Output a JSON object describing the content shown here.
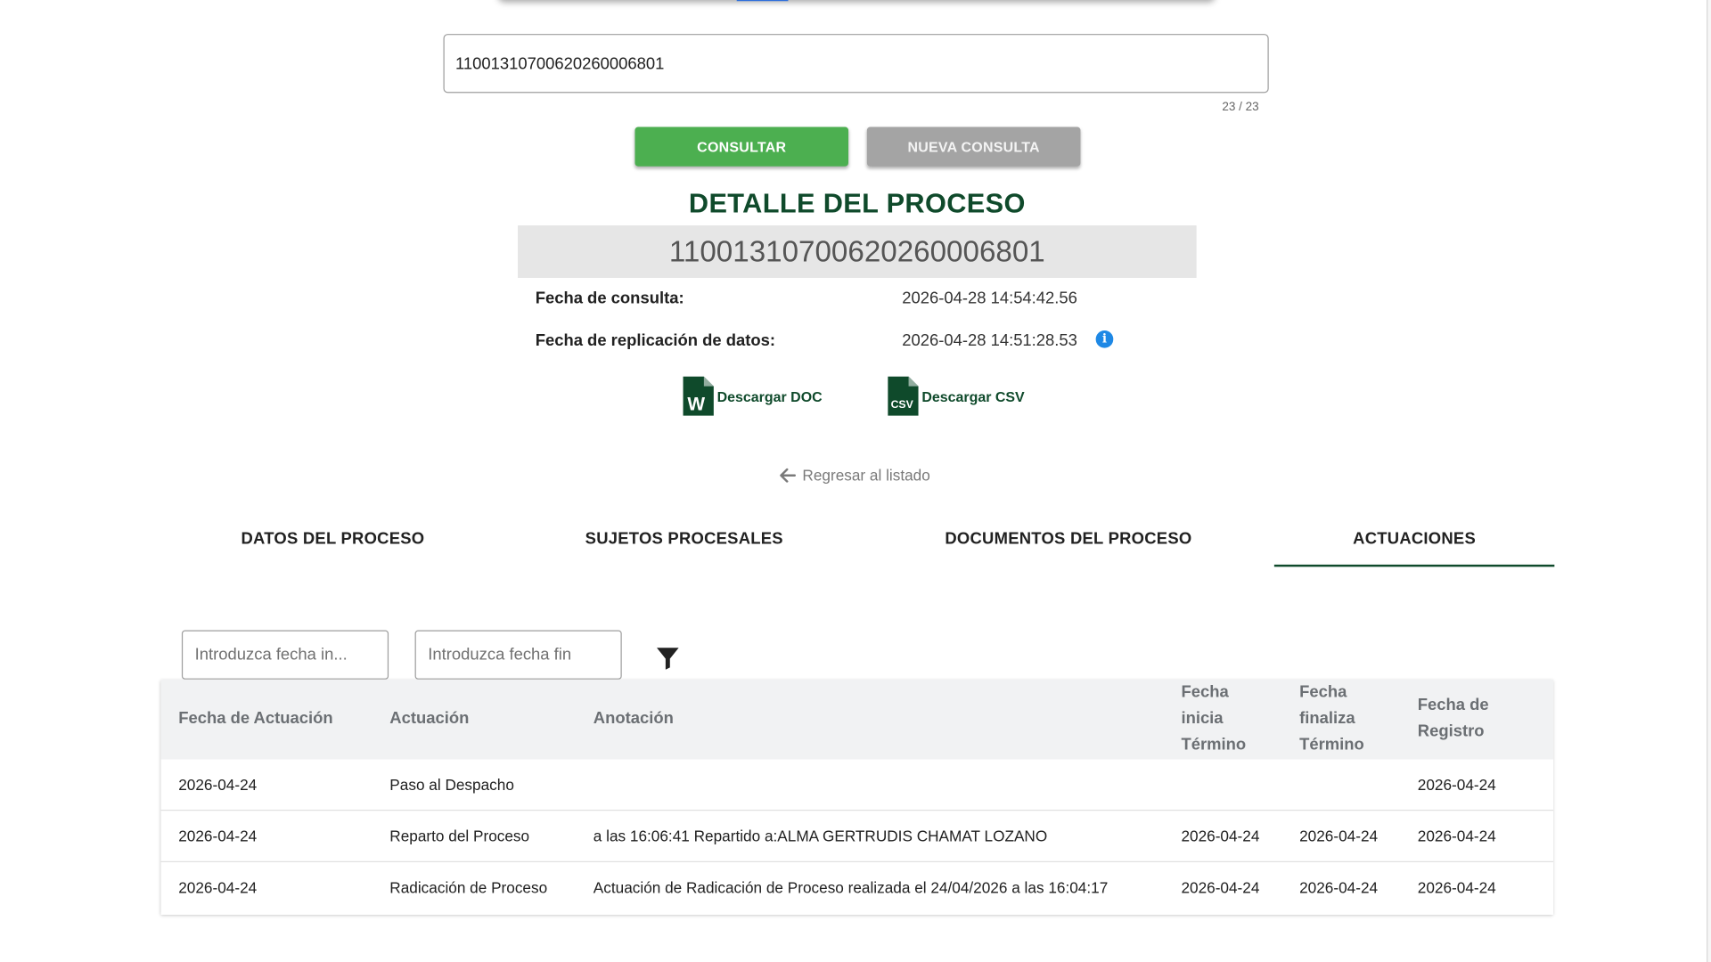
{
  "search": {
    "value": "11001310700620260006801",
    "counter": "23 / 23"
  },
  "buttons": {
    "consultar": "CONSULTAR",
    "nueva_consulta": "NUEVA CONSULTA"
  },
  "detail": {
    "title": "DETALLE DEL PROCESO",
    "process_number": "11001310700620260006801",
    "fecha_consulta_label": "Fecha de consulta:",
    "fecha_consulta_value": "2026-04-28 14:54:42.56",
    "fecha_replicacion_label": "Fecha de replicación de datos:",
    "fecha_replicacion_value": "2026-04-28 14:51:28.53"
  },
  "downloads": {
    "doc_label": "Descargar DOC",
    "csv_label": "Descargar CSV",
    "doc_icon_letter": "W",
    "csv_icon_text": "CSV"
  },
  "back_link": "Regresar al listado",
  "tabs": [
    {
      "label": "DATOS DEL PROCESO",
      "active": false
    },
    {
      "label": "SUJETOS PROCESALES",
      "active": false
    },
    {
      "label": "DOCUMENTOS DEL PROCESO",
      "active": false
    },
    {
      "label": "ACTUACIONES",
      "active": true
    }
  ],
  "filters": {
    "fecha_inicio_placeholder": "Introduzca fecha in...",
    "fecha_fin_placeholder": "Introduzca fecha fin"
  },
  "table": {
    "headers": [
      [
        "Fecha de Actuación"
      ],
      [
        "Actuación"
      ],
      [
        "Anotación"
      ],
      [
        "Fecha",
        "inicia",
        "Término"
      ],
      [
        "Fecha",
        "finaliza",
        "Término"
      ],
      [
        "Fecha de",
        "Registro"
      ]
    ],
    "rows": [
      [
        "2026-04-24",
        "Paso al Despacho",
        "",
        "",
        "",
        "2026-04-24"
      ],
      [
        "2026-04-24",
        "Reparto del Proceso",
        "a las 16:06:41 Repartido a:ALMA GERTRUDIS CHAMAT LOZANO",
        "2026-04-24",
        "2026-04-24",
        "2026-04-24"
      ],
      [
        "2026-04-24",
        "Radicación de Proceso",
        "Actuación de Radicación de Proceso realizada el 24/04/2026 a las 16:04:17",
        "2026-04-24",
        "2026-04-24",
        "2026-04-24"
      ]
    ]
  },
  "colors": {
    "primary_green": "#0f4a2b",
    "consultar_bg": "#4caf50",
    "nueva_bg": "#a4a4a4",
    "info_blue": "#1e88e5",
    "header_bg": "#f1f2f3"
  },
  "icons": [
    "arrow-left-icon",
    "info-icon",
    "word-doc-icon",
    "csv-doc-icon",
    "filter-icon"
  ]
}
